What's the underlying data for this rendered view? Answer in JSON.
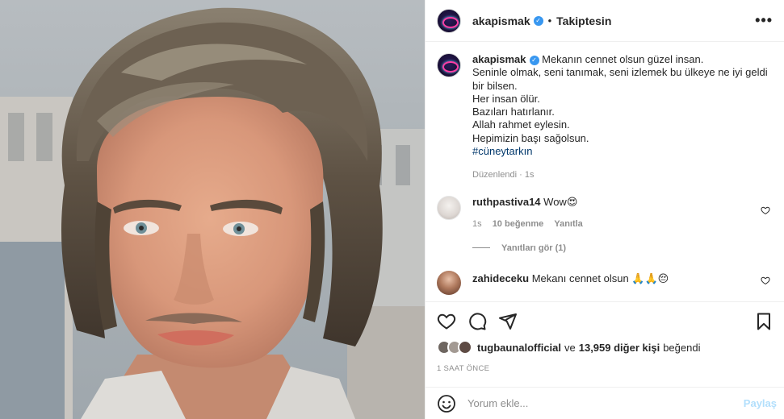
{
  "post": {
    "username": "akapismak",
    "verified_badge": "✓",
    "separator": "•",
    "follow_status": "Takiptesin",
    "more_label": "•••"
  },
  "caption": {
    "username": "akapismak",
    "lines": [
      "Mekanın cennet olsun güzel insan.",
      "Seninle olmak, seni tanımak, seni izlemek bu ülkeye ne iyi geldi bir bilsen.",
      "Her insan ölür.",
      "Bazıları hatırlanır.",
      "Allah rahmet eylesin.",
      "Hepimizin başı sağolsun."
    ],
    "hashtag": "#cüneytarkın",
    "edited": "Düzenlendi",
    "time": "1s"
  },
  "comments": [
    {
      "username": "ruthpastiva14",
      "text": "Wow😍",
      "time": "1s",
      "likes": "10 beğenme",
      "reply": "Yanıtla",
      "view_replies": "Yanıtları gör (1)"
    },
    {
      "username": "zahideceku",
      "text": "Mekanı cennet olsun 🙏🙏😔"
    }
  ],
  "likes": {
    "user": "tugbaunalofficial",
    "connector": "ve",
    "others": "13,959 diğer kişi",
    "suffix": "beğendi"
  },
  "timestamp": "1 SAAT ÖNCE",
  "add_comment": {
    "placeholder": "Yorum ekle...",
    "post_label": "Paylaş"
  },
  "icons": [
    "heart-icon",
    "comment-icon",
    "share-icon",
    "bookmark-icon",
    "emoji-icon",
    "more-icon"
  ],
  "colors": {
    "link": "#00376b",
    "verified": "#3897f0",
    "muted": "#8e8e8e",
    "post_disabled": "#b2dffc"
  }
}
